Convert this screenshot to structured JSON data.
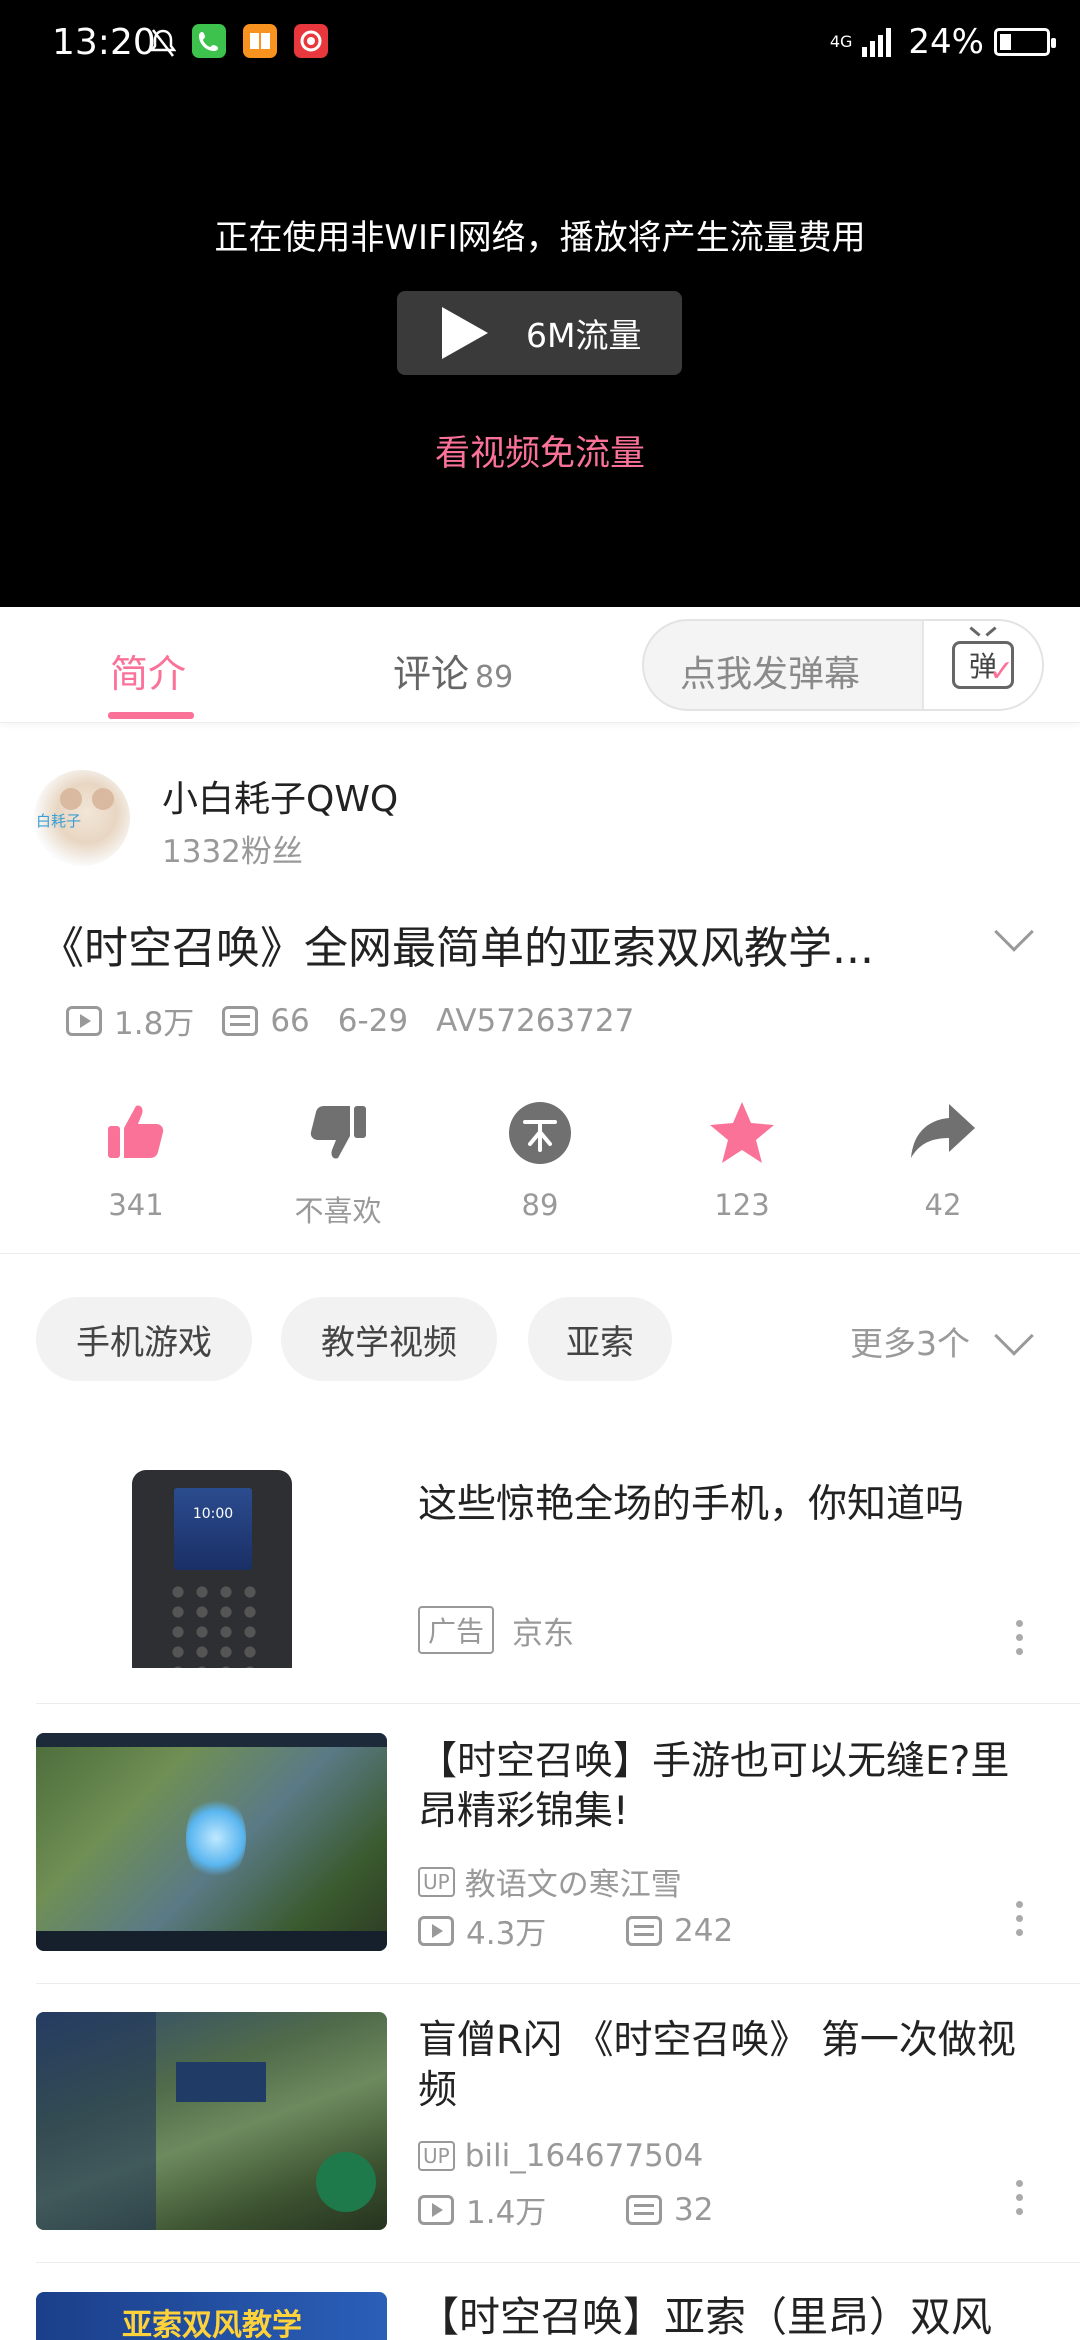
{
  "status_bar": {
    "time": "13:20",
    "network": "4G",
    "battery": "24%",
    "battery_level": 0.24
  },
  "video": {
    "notice": "正在使用非WIFI网络，播放将产生流量费用",
    "play_label": "6M流量",
    "free_link": "看视频免流量"
  },
  "tabs": {
    "intro": "简介",
    "comments": "评论",
    "comments_count": "89",
    "danmaku_placeholder": "点我发弹幕",
    "danmaku_icon_text": "弹"
  },
  "uploader": {
    "name": "小白耗子QWQ",
    "fans": "1332粉丝",
    "avatar_tag": "白耗子"
  },
  "video_info": {
    "title": "《时空召唤》全网最简单的亚索双风教学...",
    "views": "1.8万",
    "danmaku": "66",
    "date": "6-29",
    "av": "AV57263727"
  },
  "actions": {
    "like": "341",
    "dislike": "不喜欢",
    "coin": "89",
    "favorite": "123",
    "share": "42"
  },
  "tags": {
    "items": [
      "手机游戏",
      "教学视频",
      "亚索"
    ],
    "more": "更多3个"
  },
  "feed": [
    {
      "title": "这些惊艳全场的手机，你知道吗",
      "ad_label": "广告",
      "source": "京东",
      "phone_time": "10:00"
    },
    {
      "title": "【时空召唤】手游也可以无缝E?里昂精彩锦集!",
      "up_badge": "UP",
      "uploader": "教语文の寒江雪",
      "views": "4.3万",
      "danmaku": "242"
    },
    {
      "title": "盲僧R闪 《时空召唤》 第一次做视频",
      "up_badge": "UP",
      "uploader": "bili_164677504",
      "views": "1.4万",
      "danmaku": "32"
    },
    {
      "title": "【时空召唤】亚索（里昂）双风",
      "thumb_text": "亚索双风教学"
    }
  ],
  "colors": {
    "accent": "#fb7299",
    "icon_gray": "#707070"
  }
}
